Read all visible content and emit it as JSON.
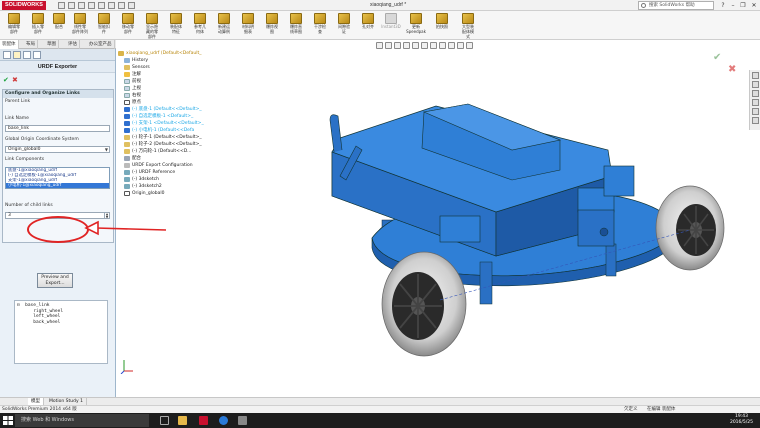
{
  "app": {
    "logo_text": "SOLIDWORKS",
    "document_title": "xiaoqiang_udrf *",
    "search_placeholder": "搜索 SolidWorks 帮助"
  },
  "ribbon": {
    "buttons": [
      {
        "label": "编辑零\n部件"
      },
      {
        "label": "插入零\n部件"
      },
      {
        "label": "配合"
      },
      {
        "label": "线性零\n部件阵列"
      },
      {
        "label": "智能扣\n件"
      },
      {
        "label": "移动零\n部件"
      },
      {
        "label": "显示隐\n藏的零\n部件"
      },
      {
        "label": "装配体\n特征"
      },
      {
        "label": "参考几\n何体"
      },
      {
        "label": "新建运\n动算例"
      },
      {
        "label": "材料明\n细表"
      },
      {
        "label": "爆炸视\n图"
      },
      {
        "label": "爆炸直\n线草图"
      },
      {
        "label": "干涉检\n查"
      },
      {
        "label": "间隙验\n证"
      },
      {
        "label": "孔对齐"
      },
      {
        "label": "Instant3D"
      },
      {
        "label": "更新\nSpeedpak"
      },
      {
        "label": "拍快照"
      },
      {
        "label": "大型装\n配体模\n式"
      }
    ]
  },
  "tabs": [
    "装配体",
    "布局",
    "草图",
    "评估",
    "办公室产品"
  ],
  "property_manager": {
    "title": "URDF Exporter",
    "group_title": "Configure and Organize Links",
    "parent_link_label": "Parent Link",
    "link_name_label": "Link Name",
    "link_name_value": "base_link",
    "coord_label": "Global Origin Coordinate System",
    "coord_value": "Origin_global0",
    "components_label": "Link Components",
    "components": [
      "底盘-1@xiaoqiang_udrf",
      "(-) 自选定模板-1@xiaoqiang_udrf",
      "支架-1@xiaoqiang_udrf",
      "小电机-1@xiaoqiang_udrf"
    ],
    "num_children_label": "Number of child links",
    "num_children_value": "3",
    "preview_button": "Preview and\nExport..."
  },
  "preview_tree": [
    "⊟  base_link",
    "      right_wheel",
    "      left_wheel",
    "      back_wheel"
  ],
  "feature_tree": [
    "xiaoqiang_udrf  (Default<Default_",
    "History",
    "Sensors",
    "注解",
    "前视",
    "上视",
    "右视",
    "原点",
    "(-) 底盘-1 (Default<<Default>_",
    "(-) 自选定模板-1 <Default>_",
    "(-) 支架-1 <Default<<Default>_",
    "(-) 小电机-1 (Default<<Defa",
    "(-) 轮子-1 (Default<<Default>_",
    "(-) 轮子-2 (Default<<Default>_",
    "(-) 万向轮-1 (Default<<D...",
    "配合",
    "URDF Export Configuration",
    "(-) URDF Reference",
    "(-) 3dsketch",
    "(-) 3dsketch2",
    "Origin_global0"
  ],
  "bottom_tabs": [
    "模型",
    "Motion Study 1"
  ],
  "status": {
    "left": "SolidWorks Premium 2014 x64 版",
    "state": "欠定义",
    "mode": "在编辑 装配体"
  },
  "taskbar": {
    "search_text": "搜索 Web 和 Windows",
    "time": "19:43",
    "date": "2016/5/25"
  },
  "colors": {
    "model_blue": "#2f7fd6",
    "annotation_red": "#e02424",
    "tree_link_cyan": "#1aa7e6"
  }
}
